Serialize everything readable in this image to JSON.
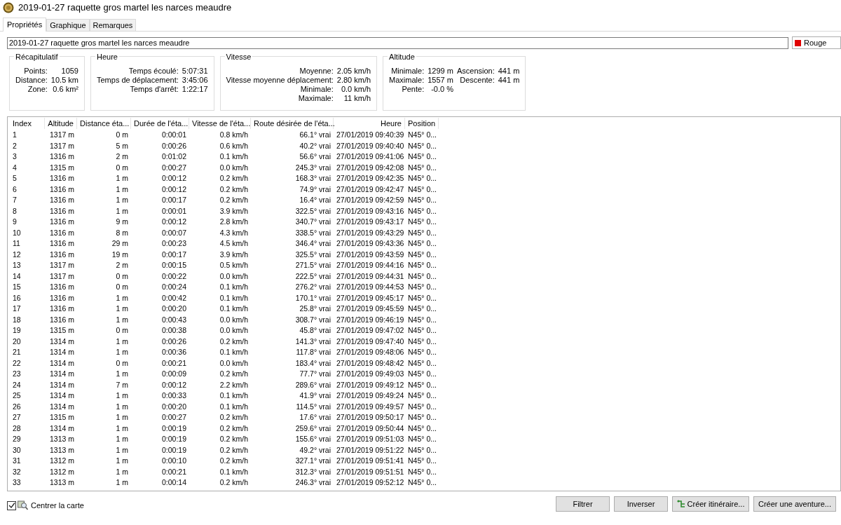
{
  "window": {
    "title": "2019-01-27 raquette gros martel les narces meaudre"
  },
  "tabs": [
    {
      "label": "Propriétés",
      "selected": true
    },
    {
      "label": "Graphique",
      "selected": false
    },
    {
      "label": "Remarques",
      "selected": false
    }
  ],
  "name_field": {
    "value": "2019-01-27 raquette gros martel les narces meaudre"
  },
  "color_select": {
    "label": "Rouge",
    "color": "#e00000"
  },
  "summary": [
    {
      "title": "Récapitulatif",
      "rows": [
        [
          "Points:",
          "1059"
        ],
        [
          "Distance:",
          "10.5 km"
        ],
        [
          "Zone:",
          "0.6 km²"
        ]
      ]
    },
    {
      "title": "Heure",
      "rows": [
        [
          "Temps écoulé:",
          "5:07:31"
        ],
        [
          "Temps de déplacement:",
          "3:45:06"
        ],
        [
          "Temps d'arrêt:",
          "1:22:17"
        ]
      ]
    },
    {
      "title": "Vitesse",
      "rows": [
        [
          "Moyenne:",
          "2.05 km/h"
        ],
        [
          "Vitesse moyenne déplacement:",
          "2.80 km/h"
        ],
        [
          "Minimale:",
          "0.0 km/h"
        ],
        [
          "Maximale:",
          "11 km/h"
        ]
      ]
    },
    {
      "title": "Altitude",
      "rows": [
        [
          "Minimale:",
          "1299 m",
          "Ascension:",
          "441 m"
        ],
        [
          "Maximale:",
          "1557 m",
          "Descente:",
          "441 m"
        ],
        [
          "Pente:",
          "-0.0 %"
        ]
      ]
    }
  ],
  "table": {
    "columns": [
      "Index",
      "Altitude",
      "Distance éta...",
      "Durée de l'éta...",
      "Vitesse de l'éta...",
      "Route désirée de l'éta...",
      "Heure",
      "Position"
    ],
    "rows": [
      [
        "1",
        "1317 m",
        "0 m",
        "0:00:01",
        "0.8 km/h",
        "66.1° vrai",
        "27/01/2019 09:40:39",
        "N45° 0..."
      ],
      [
        "2",
        "1317 m",
        "5 m",
        "0:00:26",
        "0.6 km/h",
        "40.2° vrai",
        "27/01/2019 09:40:40",
        "N45° 0..."
      ],
      [
        "3",
        "1316 m",
        "2 m",
        "0:01:02",
        "0.1 km/h",
        "56.6° vrai",
        "27/01/2019 09:41:06",
        "N45° 0..."
      ],
      [
        "4",
        "1315 m",
        "0 m",
        "0:00:27",
        "0.0 km/h",
        "245.3° vrai",
        "27/01/2019 09:42:08",
        "N45° 0..."
      ],
      [
        "5",
        "1316 m",
        "1 m",
        "0:00:12",
        "0.2 km/h",
        "168.3° vrai",
        "27/01/2019 09:42:35",
        "N45° 0..."
      ],
      [
        "6",
        "1316 m",
        "1 m",
        "0:00:12",
        "0.2 km/h",
        "74.9° vrai",
        "27/01/2019 09:42:47",
        "N45° 0..."
      ],
      [
        "7",
        "1316 m",
        "1 m",
        "0:00:17",
        "0.2 km/h",
        "16.4° vrai",
        "27/01/2019 09:42:59",
        "N45° 0..."
      ],
      [
        "8",
        "1316 m",
        "1 m",
        "0:00:01",
        "3.9 km/h",
        "322.5° vrai",
        "27/01/2019 09:43:16",
        "N45° 0..."
      ],
      [
        "9",
        "1316 m",
        "9 m",
        "0:00:12",
        "2.8 km/h",
        "340.7° vrai",
        "27/01/2019 09:43:17",
        "N45° 0..."
      ],
      [
        "10",
        "1316 m",
        "8 m",
        "0:00:07",
        "4.3 km/h",
        "338.5° vrai",
        "27/01/2019 09:43:29",
        "N45° 0..."
      ],
      [
        "11",
        "1316 m",
        "29 m",
        "0:00:23",
        "4.5 km/h",
        "346.4° vrai",
        "27/01/2019 09:43:36",
        "N45° 0..."
      ],
      [
        "12",
        "1316 m",
        "19 m",
        "0:00:17",
        "3.9 km/h",
        "325.5° vrai",
        "27/01/2019 09:43:59",
        "N45° 0..."
      ],
      [
        "13",
        "1317 m",
        "2 m",
        "0:00:15",
        "0.5 km/h",
        "271.5° vrai",
        "27/01/2019 09:44:16",
        "N45° 0..."
      ],
      [
        "14",
        "1317 m",
        "0 m",
        "0:00:22",
        "0.0 km/h",
        "222.5° vrai",
        "27/01/2019 09:44:31",
        "N45° 0..."
      ],
      [
        "15",
        "1316 m",
        "0 m",
        "0:00:24",
        "0.1 km/h",
        "276.2° vrai",
        "27/01/2019 09:44:53",
        "N45° 0..."
      ],
      [
        "16",
        "1316 m",
        "1 m",
        "0:00:42",
        "0.1 km/h",
        "170.1° vrai",
        "27/01/2019 09:45:17",
        "N45° 0..."
      ],
      [
        "17",
        "1316 m",
        "1 m",
        "0:00:20",
        "0.1 km/h",
        "25.8° vrai",
        "27/01/2019 09:45:59",
        "N45° 0..."
      ],
      [
        "18",
        "1316 m",
        "1 m",
        "0:00:43",
        "0.0 km/h",
        "308.7° vrai",
        "27/01/2019 09:46:19",
        "N45° 0..."
      ],
      [
        "19",
        "1315 m",
        "0 m",
        "0:00:38",
        "0.0 km/h",
        "45.8° vrai",
        "27/01/2019 09:47:02",
        "N45° 0..."
      ],
      [
        "20",
        "1314 m",
        "1 m",
        "0:00:26",
        "0.2 km/h",
        "141.3° vrai",
        "27/01/2019 09:47:40",
        "N45° 0..."
      ],
      [
        "21",
        "1314 m",
        "1 m",
        "0:00:36",
        "0.1 km/h",
        "117.8° vrai",
        "27/01/2019 09:48:06",
        "N45° 0..."
      ],
      [
        "22",
        "1314 m",
        "0 m",
        "0:00:21",
        "0.0 km/h",
        "183.4° vrai",
        "27/01/2019 09:48:42",
        "N45° 0..."
      ],
      [
        "23",
        "1314 m",
        "1 m",
        "0:00:09",
        "0.2 km/h",
        "77.7° vrai",
        "27/01/2019 09:49:03",
        "N45° 0..."
      ],
      [
        "24",
        "1314 m",
        "7 m",
        "0:00:12",
        "2.2 km/h",
        "289.6° vrai",
        "27/01/2019 09:49:12",
        "N45° 0..."
      ],
      [
        "25",
        "1314 m",
        "1 m",
        "0:00:33",
        "0.1 km/h",
        "41.9° vrai",
        "27/01/2019 09:49:24",
        "N45° 0..."
      ],
      [
        "26",
        "1314 m",
        "1 m",
        "0:00:20",
        "0.1 km/h",
        "114.5° vrai",
        "27/01/2019 09:49:57",
        "N45° 0..."
      ],
      [
        "27",
        "1315 m",
        "1 m",
        "0:00:27",
        "0.2 km/h",
        "17.6° vrai",
        "27/01/2019 09:50:17",
        "N45° 0..."
      ],
      [
        "28",
        "1314 m",
        "1 m",
        "0:00:19",
        "0.2 km/h",
        "259.6° vrai",
        "27/01/2019 09:50:44",
        "N45° 0..."
      ],
      [
        "29",
        "1313 m",
        "1 m",
        "0:00:19",
        "0.2 km/h",
        "155.6° vrai",
        "27/01/2019 09:51:03",
        "N45° 0..."
      ],
      [
        "30",
        "1313 m",
        "1 m",
        "0:00:19",
        "0.2 km/h",
        "49.2° vrai",
        "27/01/2019 09:51:22",
        "N45° 0..."
      ],
      [
        "31",
        "1312 m",
        "1 m",
        "0:00:10",
        "0.2 km/h",
        "327.1° vrai",
        "27/01/2019 09:51:41",
        "N45° 0..."
      ],
      [
        "32",
        "1312 m",
        "1 m",
        "0:00:21",
        "0.1 km/h",
        "312.3° vrai",
        "27/01/2019 09:51:51",
        "N45° 0..."
      ],
      [
        "33",
        "1313 m",
        "1 m",
        "0:00:14",
        "0.2 km/h",
        "246.3° vrai",
        "27/01/2019 09:52:12",
        "N45° 0..."
      ]
    ]
  },
  "center_map": {
    "label": "Centrer la carte",
    "checked": true
  },
  "buttons": [
    {
      "label": "Filtrer",
      "kind": "plain"
    },
    {
      "label": "Inverser",
      "kind": "plain"
    },
    {
      "label": "Créer itinéraire...",
      "kind": "route"
    },
    {
      "label": "Créer une aventure...",
      "kind": "plain"
    }
  ]
}
